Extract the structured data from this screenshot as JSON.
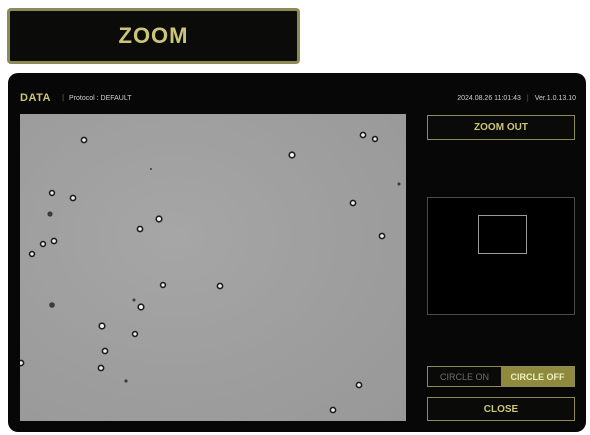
{
  "banner": {
    "title": "ZOOM"
  },
  "header": {
    "title": "DATA",
    "separator": "|",
    "protocol": "Protocol : DEFAULT",
    "datetime": "2024.08.26 11:01:43",
    "version": "Ver.1.0.13.10"
  },
  "controls": {
    "zoom_out_label": "ZOOM OUT",
    "circle_on_label": "CIRCLE ON",
    "circle_off_label": "CIRCLE OFF",
    "close_label": "CLOSE",
    "circle_state": "off"
  },
  "colors": {
    "accent": "#cbc57a",
    "accent_border": "#8d8a55",
    "active_toggle": "#8d8a3e",
    "panel_bg": "#070707"
  }
}
